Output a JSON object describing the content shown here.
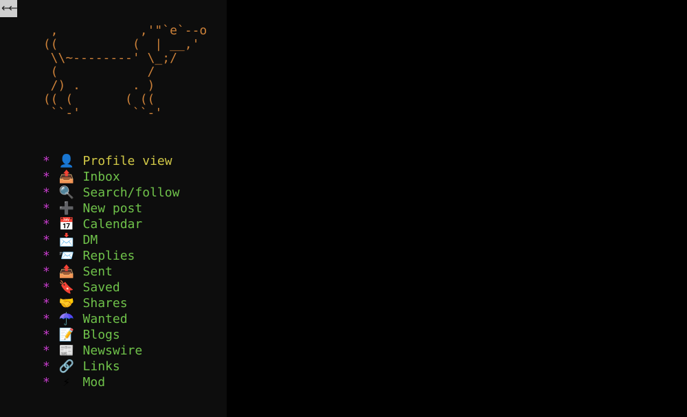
{
  "nav": {
    "back_glyph": "←←"
  },
  "ascii_art": "  ,           ,'\"`e`--o\n ((          (  | __,'\n  \\\\~--------' \\_;/\n  (            /\n  /) .       . )\n (( (       ( ((\n  ``-'       ``-'",
  "menu": {
    "bullet": "*",
    "items": [
      {
        "icon": "👤",
        "label": "Profile view",
        "name": "profile-view",
        "active": true
      },
      {
        "icon": "📤",
        "label": "Inbox",
        "name": "inbox",
        "active": false
      },
      {
        "icon": "🔍",
        "label": "Search/follow",
        "name": "search-follow",
        "active": false
      },
      {
        "icon": "➕",
        "label": "New post",
        "name": "new-post",
        "active": false
      },
      {
        "icon": "📅",
        "label": "Calendar",
        "name": "calendar",
        "active": false
      },
      {
        "icon": "📩",
        "label": "DM",
        "name": "dm",
        "active": false
      },
      {
        "icon": "📨",
        "label": "Replies",
        "name": "replies",
        "active": false
      },
      {
        "icon": "📤",
        "label": "Sent",
        "name": "sent",
        "active": false
      },
      {
        "icon": "🔖",
        "label": "Saved",
        "name": "saved",
        "active": false
      },
      {
        "icon": "🤝",
        "label": "Shares",
        "name": "shares",
        "active": false
      },
      {
        "icon": "☂️",
        "label": "Wanted",
        "name": "wanted",
        "active": false
      },
      {
        "icon": "📝",
        "label": "Blogs",
        "name": "blogs",
        "active": false
      },
      {
        "icon": "📰",
        "label": "Newswire",
        "name": "newswire",
        "active": false
      },
      {
        "icon": "🔗",
        "label": "Links",
        "name": "links",
        "active": false
      },
      {
        "icon": "⚡",
        "label": "Mod",
        "name": "mod",
        "active": false
      }
    ]
  }
}
